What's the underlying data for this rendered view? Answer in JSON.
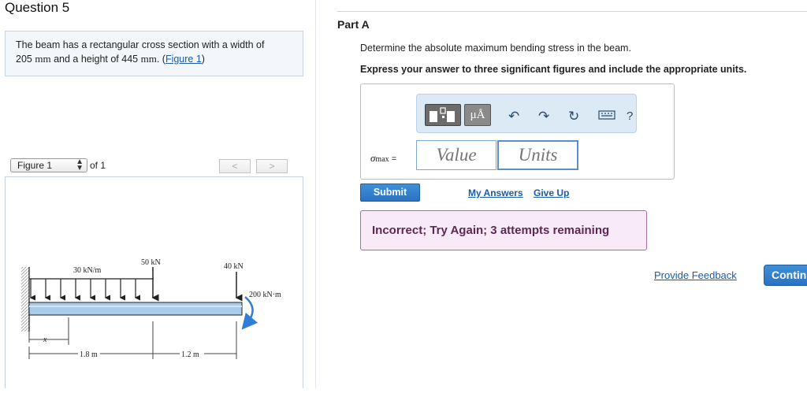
{
  "question": {
    "title": "Question 5",
    "problem_text_1": "The beam has a rectangular cross section with a width of",
    "problem_value_width": "205",
    "problem_unit_width": "mm",
    "problem_text_2": "and a height of 445",
    "problem_unit_height": "mm",
    "problem_text_3": ". (",
    "figure_link": "Figure 1",
    "problem_text_4": ")"
  },
  "figure": {
    "selector_value": "Figure 1",
    "of_label": "of 1",
    "prev_label": "<",
    "next_label": ">",
    "labels": {
      "distributed_load": "30 kN/m",
      "point_load_1": "50 kN",
      "point_load_2": "40 kN",
      "moment": "200 kN·m",
      "x_label": "x",
      "length_1": "1.8 m",
      "length_2": "1.2 m"
    }
  },
  "part": {
    "title": "Part A",
    "question_text": "Determine the absolute maximum bending stress in the beam.",
    "instruction_text": "Express your answer to three significant figures and include the appropriate units.",
    "toolbar": {
      "units_tool_label": "μÅ",
      "help_label": "?"
    },
    "answer_label_main": "σ",
    "answer_label_sub": "max",
    "answer_label_eq": " =",
    "value_placeholder": "Value",
    "units_placeholder": "Units",
    "submit_label": "Submit",
    "my_answers_label": "My Answers",
    "give_up_label": "Give Up",
    "feedback_text": "Incorrect; Try Again; 3 attempts remaining"
  },
  "footer": {
    "provide_feedback_label": "Provide Feedback",
    "continue_label": "Continue"
  },
  "colors": {
    "accent_blue": "#2b72c0",
    "feedback_bg": "#f9eaf7",
    "feedback_border": "#a670a0",
    "load_arrow": "#222222",
    "moment_arrow": "#2f7fd6",
    "beam_fill": "#a9cde8"
  },
  "icons": [
    "templates-icon",
    "undo-icon",
    "redo-icon",
    "reset-icon",
    "keyboard-icon",
    "help-icon",
    "updown-arrows-icon",
    "moment-arrow-icon"
  ]
}
